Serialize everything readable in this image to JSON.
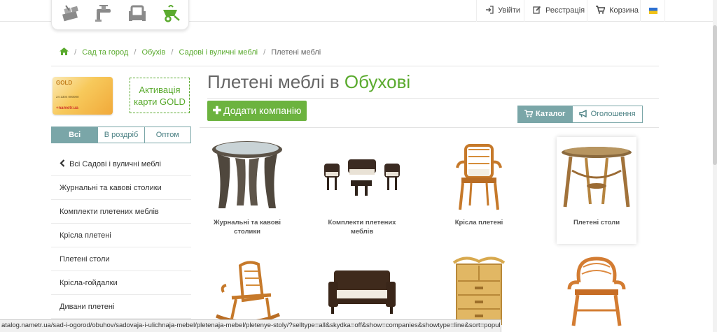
{
  "topbar": {
    "category_icons": [
      "bricks-trowel-icon",
      "faucet-icon",
      "armchair-icon",
      "wheelbarrow-icon"
    ],
    "login_label": "Увійти",
    "register_label": "Реєстрація",
    "cart_label": "Корзина",
    "language": "ukrainian-flag-icon"
  },
  "breadcrumb": {
    "items": [
      "Сад та город",
      "Обухів",
      "Садові і вуличні меблі"
    ],
    "current": "Плетені меблі"
  },
  "sidebar": {
    "gold_card": {
      "logo": "GOLD",
      "card_number": "24 1304 000000",
      "brand": "nametr.ua"
    },
    "activate_label_line1": "Активація",
    "activate_label_line2": "карти GOLD",
    "filters": [
      "Всі",
      "В роздріб",
      "Оптом"
    ],
    "active_filter": "Всі",
    "back_label": "Всі Садові і вуличні меблі",
    "items": [
      "Журнальні та кавові столики",
      "Комплекти плетених меблів",
      "Крісла плетені",
      "Плетені столи",
      "Крісла-гойдалки",
      "Дивани плетені"
    ]
  },
  "main": {
    "title_prefix": "Плетені меблі в ",
    "title_city": "Обухові",
    "add_company_label": "Додати компанію",
    "view_toggle": {
      "catalog": "Каталог",
      "ads": "Оголошення",
      "active": "Каталог"
    },
    "tiles": [
      {
        "label": "Журнальні та кавові столики"
      },
      {
        "label": "Комплекти плетених меблів"
      },
      {
        "label": "Крісла плетені"
      },
      {
        "label": "Плетені столи"
      },
      {
        "label": ""
      },
      {
        "label": ""
      },
      {
        "label": ""
      },
      {
        "label": ""
      }
    ]
  },
  "status_bar": {
    "url": "atalog.nametr.ua/sad-i-ogorod/obuhov/sadovaja-i-ulichnaja-mebel/pletenaja-mebel/pletenye-stoly/?selltype=all&skydka=off&show=companies&showtype=line&sort=popular"
  },
  "colors": {
    "accent_green": "#5aaa2e",
    "button_green": "#6cb33f",
    "teal": "#7aa6a8"
  }
}
